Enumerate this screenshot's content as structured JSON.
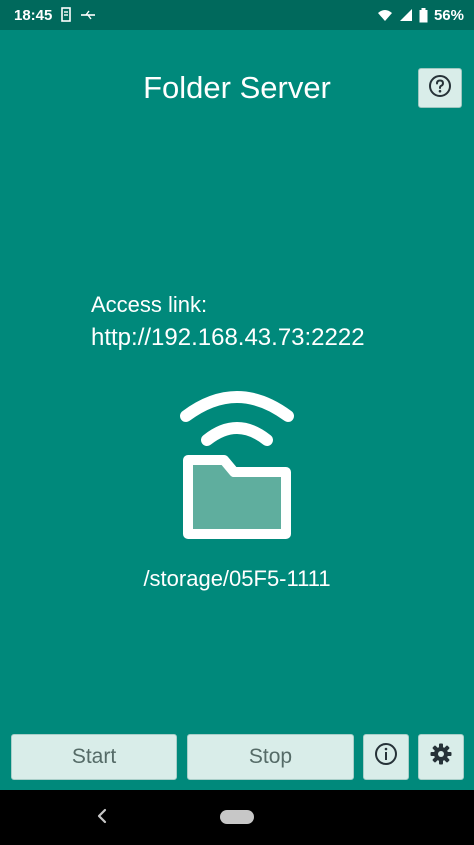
{
  "status_bar": {
    "time": "18:45",
    "battery": "56%",
    "icons": [
      "notification-icon",
      "usb-icon",
      "wifi-icon",
      "signal-icon",
      "battery-icon"
    ]
  },
  "app": {
    "title": "Folder Server",
    "help_icon": "help-icon"
  },
  "server": {
    "access_label": "Access link:",
    "access_url": "http://192.168.43.73:2222",
    "folder_path": "/storage/05F5-1111",
    "graphic_icon": "wifi-folder-icon"
  },
  "buttons": {
    "start_label": "Start",
    "stop_label": "Stop",
    "info_icon": "info-icon",
    "settings_icon": "gear-icon"
  },
  "nav": {
    "icons": [
      "back-icon",
      "home-pill-icon"
    ]
  },
  "colors": {
    "primary": "#00897B",
    "status_bar": "#00695C",
    "button_bg": "#d9ede9",
    "button_text": "#556b67",
    "nav_bar": "#000000"
  }
}
